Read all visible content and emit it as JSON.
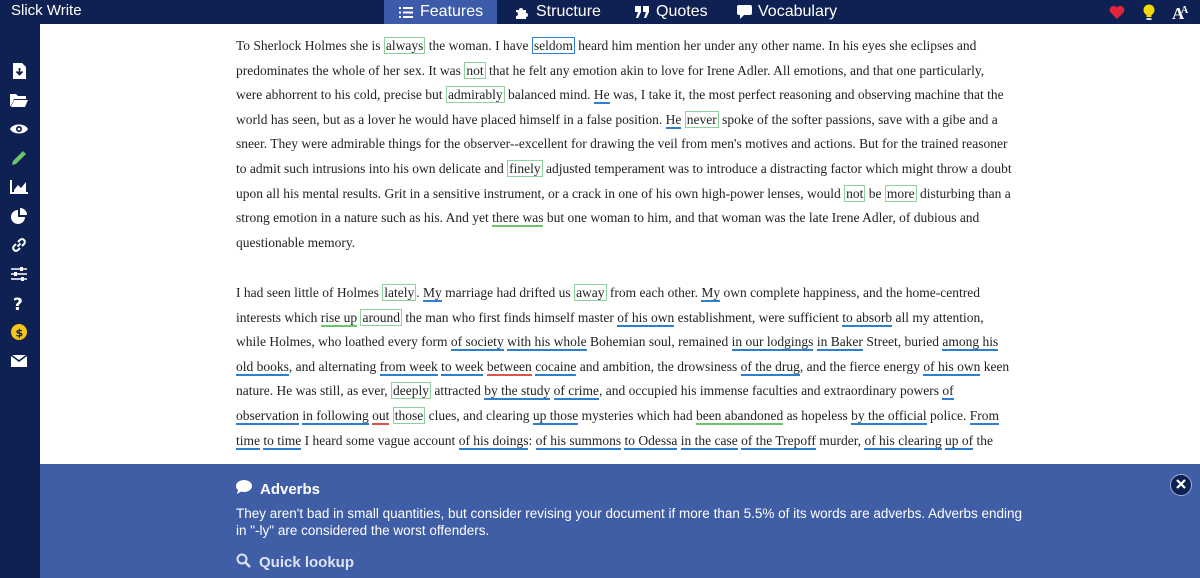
{
  "app": {
    "title": "Slick Write"
  },
  "tabs": [
    {
      "label": "Features",
      "icon": "list-icon",
      "active": true
    },
    {
      "label": "Structure",
      "icon": "puzzle-icon"
    },
    {
      "label": "Quotes",
      "icon": "quote-icon"
    },
    {
      "label": "Vocabulary",
      "icon": "speech-bubble-icon"
    }
  ],
  "top_right_icons": [
    "heart-icon",
    "lightbulb-icon",
    "font-size-icon"
  ],
  "sidebar_icons": [
    "save-file-icon",
    "open-folder-icon",
    "eye-icon",
    "pencil-icon",
    "line-chart-icon",
    "pie-chart-icon",
    "link-icon",
    "sliders-icon",
    "help-icon",
    "donate-dollar-icon",
    "mail-icon"
  ],
  "document": {
    "paragraph1": [
      {
        "t": "To Sherlock Holmes she is "
      },
      {
        "t": "always",
        "s": "g"
      },
      {
        "t": " the woman. I have "
      },
      {
        "t": "seldom",
        "s": "bx"
      },
      {
        "t": " heard him mention her under any other name. In his eyes she eclipses and predominates the whole of her sex. It was "
      },
      {
        "t": "not",
        "s": "g"
      },
      {
        "t": " that he felt any emotion akin to love for Irene Adler. All emotions, and that one particularly, were abhorrent to his cold, precise but "
      },
      {
        "t": "admirably",
        "s": "g"
      },
      {
        "t": " balanced mind. "
      },
      {
        "t": "He",
        "s": "bl"
      },
      {
        "t": " was, I take it, the most perfect reasoning and observing machine that the world has seen, but as a lover he would have placed himself in a false position. "
      },
      {
        "t": "He",
        "s": "bl"
      },
      {
        "t": " "
      },
      {
        "t": "never",
        "s": "g"
      },
      {
        "t": " spoke of the softer passions, save with a gibe and a sneer. They were admirable things for the observer--excellent for drawing the veil from men's motives and actions. But for the trained reasoner to admit such intrusions into his own delicate and "
      },
      {
        "t": "finely",
        "s": "g"
      },
      {
        "t": " adjusted temperament was to introduce a distracting factor which might throw a doubt upon all his mental results. Grit in a sensitive instrument, or a crack in one of his own high-power lenses, would "
      },
      {
        "t": "not",
        "s": "g"
      },
      {
        "t": " be "
      },
      {
        "t": "more",
        "s": "g"
      },
      {
        "t": " disturbing than a strong emotion in a nature such as his. And yet "
      },
      {
        "t": "there was",
        "s": "gu"
      },
      {
        "t": " but one woman to him, and that woman was the late Irene Adler, of dubious and questionable memory."
      }
    ],
    "paragraph2": [
      {
        "t": "I had seen little of Holmes "
      },
      {
        "t": "lately",
        "s": "g"
      },
      {
        "t": ". "
      },
      {
        "t": "My",
        "s": "bl"
      },
      {
        "t": " marriage had drifted us "
      },
      {
        "t": "away",
        "s": "g"
      },
      {
        "t": " from each other. "
      },
      {
        "t": "My",
        "s": "bl"
      },
      {
        "t": " own complete happiness, and the home-centred interests which "
      },
      {
        "t": "rise up",
        "s": "gu"
      },
      {
        "t": " "
      },
      {
        "t": "around",
        "s": "g"
      },
      {
        "t": " the man who first finds himself master "
      },
      {
        "t": "of his own",
        "s": "bl"
      },
      {
        "t": " establishment, were sufficient "
      },
      {
        "t": "to absorb",
        "s": "bl"
      },
      {
        "t": " all my attention, while Holmes, who loathed every form "
      },
      {
        "t": "of society",
        "s": "bl"
      },
      {
        "t": " "
      },
      {
        "t": "with his whole",
        "s": "bl"
      },
      {
        "t": " Bohemian soul, remained "
      },
      {
        "t": "in our lodgings",
        "s": "bl"
      },
      {
        "t": " "
      },
      {
        "t": "in Baker",
        "s": "bl"
      },
      {
        "t": " Street, buried "
      },
      {
        "t": "among his old books",
        "s": "bl"
      },
      {
        "t": ", and alternating "
      },
      {
        "t": "from week",
        "s": "bl"
      },
      {
        "t": " "
      },
      {
        "t": "to week",
        "s": "bl"
      },
      {
        "t": " "
      },
      {
        "t": "between",
        "s": "rd"
      },
      {
        "t": " "
      },
      {
        "t": "cocaine",
        "s": "bl"
      },
      {
        "t": " and ambition, the drowsiness "
      },
      {
        "t": "of the drug",
        "s": "bl"
      },
      {
        "t": ", and the fierce energy "
      },
      {
        "t": "of his own",
        "s": "bl"
      },
      {
        "t": " keen nature. He was still, as ever, "
      },
      {
        "t": "deeply",
        "s": "g"
      },
      {
        "t": " attracted "
      },
      {
        "t": "by the study",
        "s": "bl"
      },
      {
        "t": " "
      },
      {
        "t": "of crime",
        "s": "bl"
      },
      {
        "t": ", and occupied his immense faculties and extraordinary powers "
      },
      {
        "t": "of observation",
        "s": "bl"
      },
      {
        "t": " "
      },
      {
        "t": "in following",
        "s": "bl"
      },
      {
        "t": " "
      },
      {
        "t": "out",
        "s": "rd"
      },
      {
        "t": " "
      },
      {
        "t": "those",
        "s": "g"
      },
      {
        "t": " clues, and clearing "
      },
      {
        "t": "up those",
        "s": "bl"
      },
      {
        "t": " mysteries which had "
      },
      {
        "t": "been abandoned",
        "s": "gu"
      },
      {
        "t": " as hopeless "
      },
      {
        "t": "by the official",
        "s": "bl"
      },
      {
        "t": " police. "
      },
      {
        "t": "From time",
        "s": "bl"
      },
      {
        "t": " "
      },
      {
        "t": "to time",
        "s": "bl"
      },
      {
        "t": " I heard some vague account "
      },
      {
        "t": "of his doings",
        "s": "bl"
      },
      {
        "t": ": "
      },
      {
        "t": "of his summons",
        "s": "bl"
      },
      {
        "t": " "
      },
      {
        "t": "to Odessa",
        "s": "bl"
      },
      {
        "t": " "
      },
      {
        "t": "in the case",
        "s": "bl"
      },
      {
        "t": " "
      },
      {
        "t": "of the Trepoff",
        "s": "bl"
      },
      {
        "t": " murder, "
      },
      {
        "t": "of his clearing",
        "s": "bl"
      },
      {
        "t": " "
      },
      {
        "t": "up of",
        "s": "bl"
      },
      {
        "t": " the"
      }
    ]
  },
  "panel": {
    "heading": "Adverbs",
    "body": "They aren't bad in small quantities, but consider revising your document if more than 5.5% of its words are adverbs. Adverbs ending in \"-ly\" are considered the worst offenders.",
    "lookup_label": "Quick lookup",
    "close_icon": "close-icon"
  },
  "colors": {
    "topbar": "#0f2152",
    "active_tab": "#3c5ba8",
    "panel": "#3f5ea6",
    "green_highlight": "#8fd19a",
    "blue_underline": "#2f7fd1",
    "red_underline": "#e0524a",
    "heart": "#e0243a",
    "bulb": "#f5d90a"
  }
}
